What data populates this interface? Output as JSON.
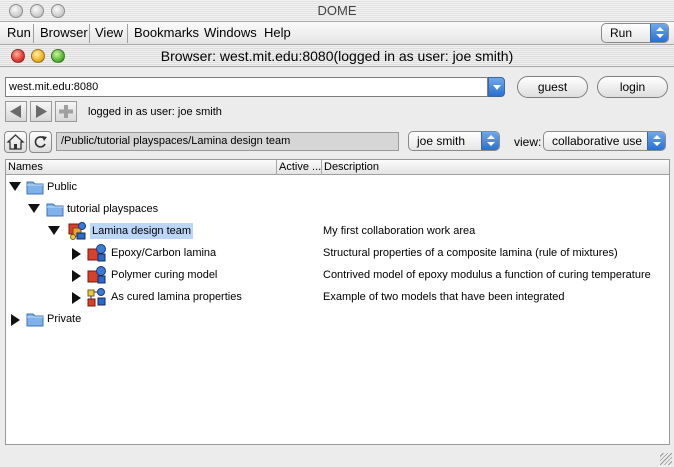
{
  "app": {
    "title": "DOME"
  },
  "menubar": {
    "items": [
      "Run",
      "Browser",
      "View",
      "Bookmarks",
      "Windows",
      "Help"
    ],
    "run_select": "Run"
  },
  "window": {
    "title": "Browser: west.mit.edu:8080(logged in as user: joe smith)"
  },
  "toolbar": {
    "server": "west.mit.edu:8080",
    "guest_label": "guest",
    "login_label": "login",
    "status": "logged in as user: joe smith"
  },
  "location": {
    "path": "/Public/tutorial playspaces/Lamina design team",
    "user_select": "joe smith",
    "view_label": "view:",
    "view_select": "collaborative use"
  },
  "tree": {
    "columns": [
      "Names",
      "Active ...",
      "Description"
    ],
    "rows": [
      {
        "label": "Public",
        "desc": "",
        "expanded": true,
        "icon": "folder-icon"
      },
      {
        "label": "tutorial playspaces",
        "desc": "",
        "expanded": true,
        "icon": "folder-icon"
      },
      {
        "label": "Lamina design team",
        "desc": "My first collaboration work area",
        "expanded": true,
        "icon": "playspace-icon",
        "selected": true
      },
      {
        "label": "Epoxy/Carbon lamina",
        "desc": "Structural properties of a composite lamina (rule of mixtures)",
        "expanded": false,
        "icon": "model-icon"
      },
      {
        "label": "Polymer curing model",
        "desc": "Contrived model  of epoxy modulus a function of curing temperature",
        "expanded": false,
        "icon": "model-icon"
      },
      {
        "label": "As cured lamina properties",
        "desc": "Example of two models that have been integrated",
        "expanded": false,
        "icon": "integration-model-icon"
      },
      {
        "label": "Private",
        "desc": "",
        "expanded": false,
        "icon": "folder-icon"
      }
    ]
  },
  "colors": {
    "selection": "#bcd6f7",
    "aqua_blue": "#2a6fd1",
    "folder_blue": "#7fb2e8"
  }
}
